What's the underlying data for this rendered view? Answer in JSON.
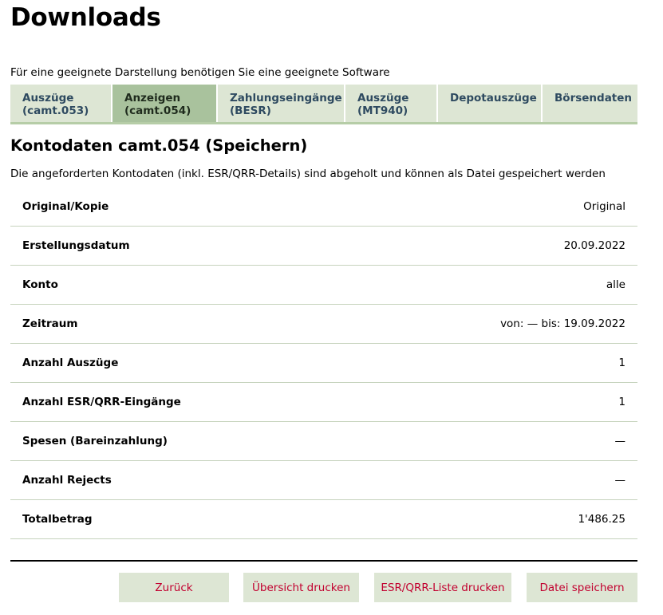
{
  "page": {
    "title": "Downloads",
    "hint": "Für eine geeignete Darstellung benötigen Sie eine geeignete Software"
  },
  "tabs": [
    {
      "line1": "Auszüge",
      "line2": "(camt.053)",
      "active": false
    },
    {
      "line1": "Anzeigen",
      "line2": "(camt.054)",
      "active": true
    },
    {
      "line1": "Zahlungseingänge",
      "line2": "(BESR)",
      "active": false
    },
    {
      "line1": "Auszüge",
      "line2": "(MT940)",
      "active": false
    },
    {
      "line1": "Depotauszüge",
      "line2": "",
      "active": false
    },
    {
      "line1": "Börsendaten",
      "line2": "",
      "active": false
    }
  ],
  "section": {
    "title": "Kontodaten camt.054 (Speichern)",
    "description": "Die angeforderten Kontodaten (inkl. ESR/QRR-Details) sind abgeholt und können als Datei gespeichert werden"
  },
  "details": [
    {
      "label": "Original/Kopie",
      "value": "Original"
    },
    {
      "label": "Erstellungsdatum",
      "value": "20.09.2022"
    },
    {
      "label": "Konto",
      "value": "alle"
    },
    {
      "label": "Zeitraum",
      "value": "von: — bis: 19.09.2022"
    },
    {
      "label": "Anzahl Auszüge",
      "value": "1"
    },
    {
      "label": "Anzahl ESR/QRR-Eingänge",
      "value": "1"
    },
    {
      "label": "Spesen (Bareinzahlung)",
      "value": "—"
    },
    {
      "label": "Anzahl Rejects",
      "value": "—"
    },
    {
      "label": "Totalbetrag",
      "value": "1'486.25"
    }
  ],
  "buttons": {
    "back": "Zurück",
    "print_overview": "Übersicht drucken",
    "print_list": "ESR/QRR-Liste drucken",
    "save_file": "Datei speichern"
  },
  "colors": {
    "tab_bg": "#dde6d4",
    "tab_active_bg": "#a9c29d",
    "button_text": "#c2002f"
  }
}
